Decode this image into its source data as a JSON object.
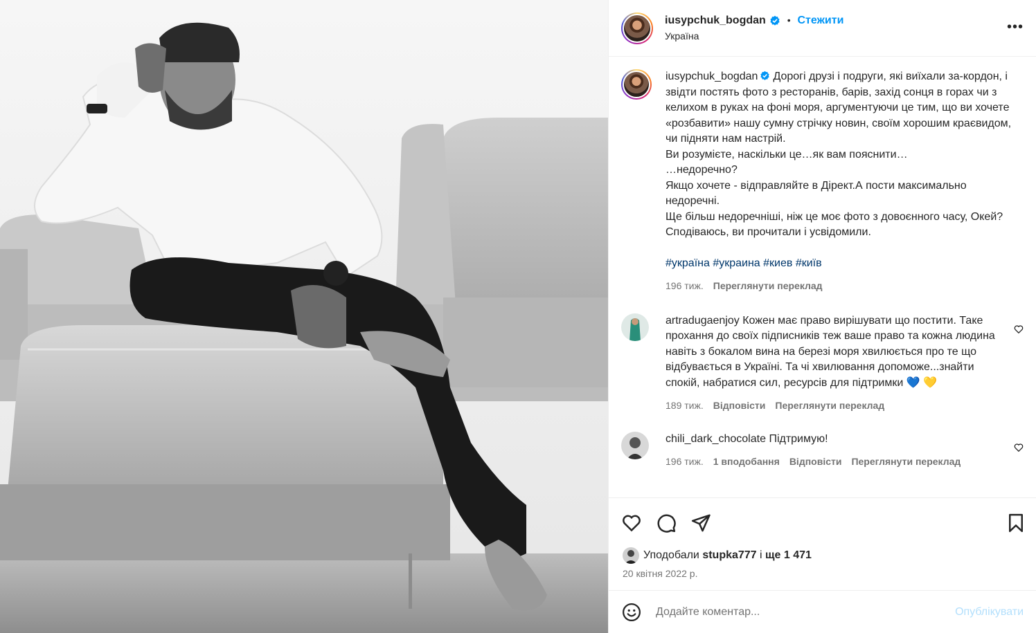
{
  "post": {
    "author": "iusypchuk_bogdan",
    "follow_label": "Стежити",
    "location": "Україна",
    "more_label": "•••"
  },
  "caption": {
    "username": "iusypchuk_bogdan",
    "text": "Дорогі друзі і подруги, які виїхали за-кордон, і звідти постять фото з ресторанів, барів, захід сонця в горах чи з келихом в руках на фоні моря, аргументуючи це тим, що ви хочете «розбавити» нашу сумну стрічку новин, своїм хорошим краєвидом, чи підняти нам настрій.\nВи розумієте, наскільки це…як вам пояснити…\n…недоречно?\nЯкщо хочете - відправляйте в Дірект.А пости максимально недоречні.\nЩе більш недоречніші, ніж це моє фото з довоєнного часу, Окей?\nСподіваюсь, ви прочитали і усвідомили.",
    "hashtags": "#україна #украина #киев #київ",
    "time": "196 тиж.",
    "translate": "Переглянути переклад"
  },
  "comments": [
    {
      "username": "artradugaenjoy",
      "text": "Кожен має право вирішувати що постити. Таке прохання до своїх підписників теж ваше право та кожна людина навіть з бокалом вина на березі моря хвилюється про те що відбувається в Україні. Та чі хвилювання допоможе...знайти спокій, набратися сил, ресурсів для підтримки 💙 💛",
      "time": "189 тиж.",
      "reply": "Відповісти",
      "translate": "Переглянути переклад"
    },
    {
      "username": "chili_dark_chocolate",
      "text": "Підтримую!",
      "time": "196 тиж.",
      "likes": "1 вподобання",
      "reply": "Відповісти",
      "translate": "Переглянути переклад"
    }
  ],
  "likes": {
    "prefix": "Уподобали",
    "user": "stupka777",
    "middle": "і",
    "rest": "ще 1 471"
  },
  "date": "20 квітня 2022 р.",
  "add_comment": {
    "placeholder": "Додайте коментар...",
    "publish": "Опублікувати"
  },
  "colors": {
    "accent": "#0095f6",
    "publish_disabled": "#b2dffc",
    "hashtag": "#00376b",
    "muted": "#737373"
  }
}
